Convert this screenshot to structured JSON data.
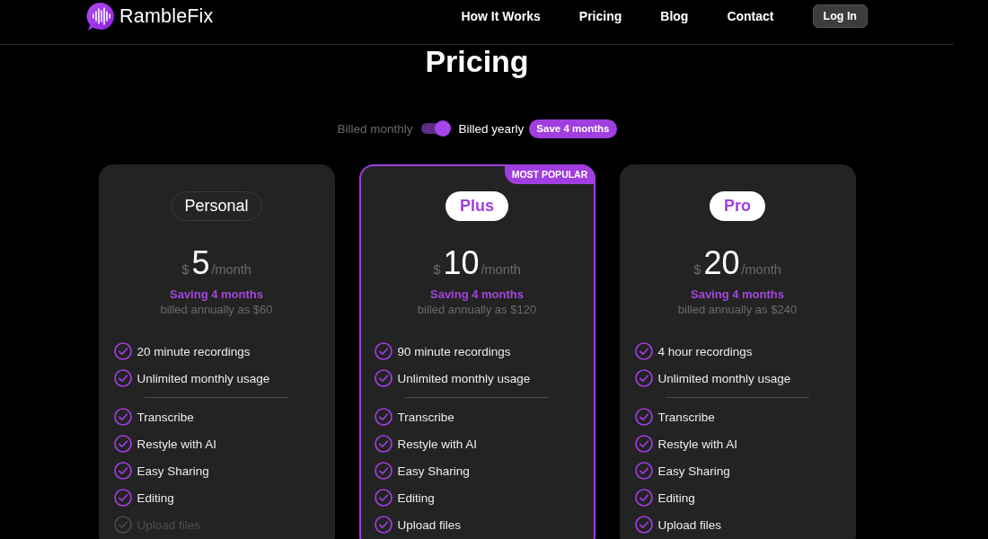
{
  "nav": {
    "brand": "RambleFix",
    "links": [
      {
        "label": "How It Works"
      },
      {
        "label": "Pricing"
      },
      {
        "label": "Blog"
      },
      {
        "label": "Contact"
      }
    ],
    "login": "Log In"
  },
  "title": "Pricing",
  "billing": {
    "monthly_label": "Billed monthly",
    "yearly_label": "Billed yearly",
    "yearly": true,
    "badge": "Save 4 months"
  },
  "plans": [
    {
      "name": "Personal",
      "name_filled": false,
      "featured": false,
      "currency": "$",
      "amount": "5",
      "period": "/month",
      "saving": "Saving 4 months",
      "billed_note": "billed annually as $60",
      "features_top": [
        {
          "text": "20 minute recordings",
          "included": true
        },
        {
          "text": "Unlimited monthly usage",
          "included": true
        }
      ],
      "features_bottom": [
        {
          "text": "Transcribe",
          "included": true
        },
        {
          "text": "Restyle with AI",
          "included": true
        },
        {
          "text": "Easy Sharing",
          "included": true
        },
        {
          "text": "Editing",
          "included": true
        },
        {
          "text": "Upload files",
          "included": false
        }
      ]
    },
    {
      "name": "Plus",
      "name_filled": true,
      "featured": true,
      "ribbon": "MOST POPULAR",
      "currency": "$",
      "amount": "10",
      "period": "/month",
      "saving": "Saving 4 months",
      "billed_note": "billed annually as $120",
      "features_top": [
        {
          "text": "90 minute recordings",
          "included": true
        },
        {
          "text": "Unlimited monthly usage",
          "included": true
        }
      ],
      "features_bottom": [
        {
          "text": "Transcribe",
          "included": true
        },
        {
          "text": "Restyle with AI",
          "included": true
        },
        {
          "text": "Easy Sharing",
          "included": true
        },
        {
          "text": "Editing",
          "included": true
        },
        {
          "text": "Upload files",
          "included": true
        }
      ]
    },
    {
      "name": "Pro",
      "name_filled": true,
      "featured": false,
      "currency": "$",
      "amount": "20",
      "period": "/month",
      "saving": "Saving 4 months",
      "billed_note": "billed annually as $240",
      "features_top": [
        {
          "text": "4 hour recordings",
          "included": true
        },
        {
          "text": "Unlimited monthly usage",
          "included": true
        }
      ],
      "features_bottom": [
        {
          "text": "Transcribe",
          "included": true
        },
        {
          "text": "Restyle with AI",
          "included": true
        },
        {
          "text": "Easy Sharing",
          "included": true
        },
        {
          "text": "Editing",
          "included": true
        },
        {
          "text": "Upload files",
          "included": true
        }
      ]
    }
  ]
}
